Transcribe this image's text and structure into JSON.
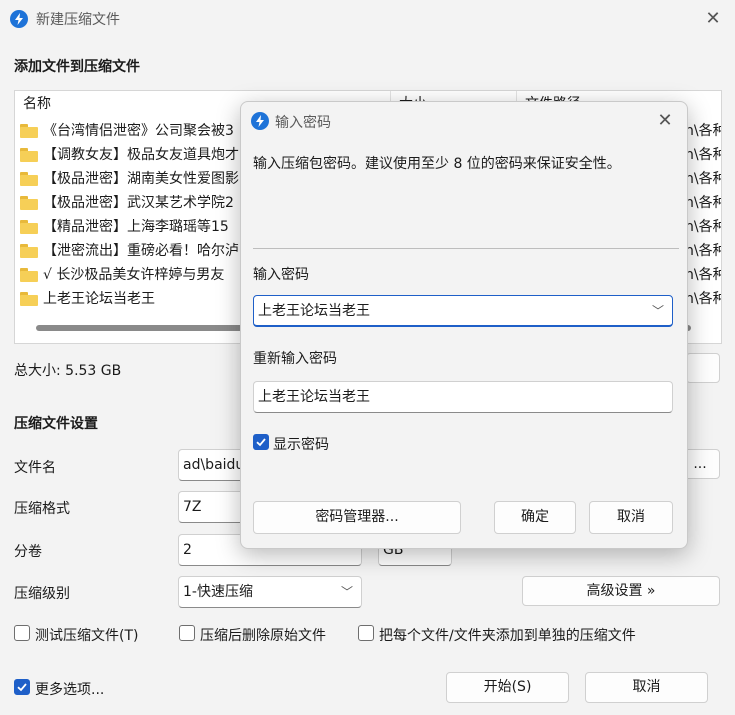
{
  "window": {
    "title": "新建压缩文件",
    "section_add": "添加文件到压缩文件",
    "list": {
      "columns": [
        "名称",
        "大小",
        "文件路径"
      ],
      "rows": [
        {
          "name": "《台湾情侣泄密》公司聚会被3",
          "path": "n\\各种"
        },
        {
          "name": "【调教女友】极品女友道具炮才",
          "path": "n\\各种"
        },
        {
          "name": "【极品泄密】湖南美女性爱图影",
          "path": "n\\各种"
        },
        {
          "name": "【极品泄密】武汉某艺术学院2",
          "path": "n\\各种"
        },
        {
          "name": "【精品泄密】上海李璐瑶等15",
          "path": "n\\各种"
        },
        {
          "name": "【泄密流出】重磅必看！哈尔泸",
          "path": "n\\各种"
        },
        {
          "name": "√ 长沙极品美女许梓婷与男友",
          "path": "n\\各种"
        },
        {
          "name": "上老王论坛当老王",
          "path": "n\\各种"
        }
      ]
    },
    "total_size": "总大小: 5.53 GB",
    "section_settings": "压缩文件设置",
    "filename_label": "文件名",
    "filename_value": "ad\\baidu",
    "browse_label": "...",
    "format_label": "压缩格式",
    "format_value": "7Z",
    "split_label": "分卷",
    "split_value": "2",
    "split_unit": "GB",
    "level_label": "压缩级别",
    "level_value": "1-快速压缩",
    "advanced_button": "高级设置 »",
    "check_test": "测试压缩文件(T)",
    "check_delete": "压缩后删除原始文件",
    "check_each": "把每个文件/文件夹添加到单独的压缩文件",
    "more_options": "更多选项...",
    "start_button": "开始(S)",
    "cancel_button": "取消"
  },
  "dialog": {
    "title": "输入密码",
    "description": "输入压缩包密码。建议使用至少 8 位的密码来保证安全性。",
    "password_label": "输入密码",
    "password_value": "上老王论坛当老王",
    "reenter_label": "重新输入密码",
    "reenter_value": "上老王论坛当老王",
    "show_password": "显示密码",
    "manager_button": "密码管理器...",
    "ok_button": "确定",
    "cancel_button": "取消"
  },
  "colors": {
    "accent": "#1e5fc8",
    "app_icon": "#1e73d8",
    "folder": "#f6cf57"
  }
}
